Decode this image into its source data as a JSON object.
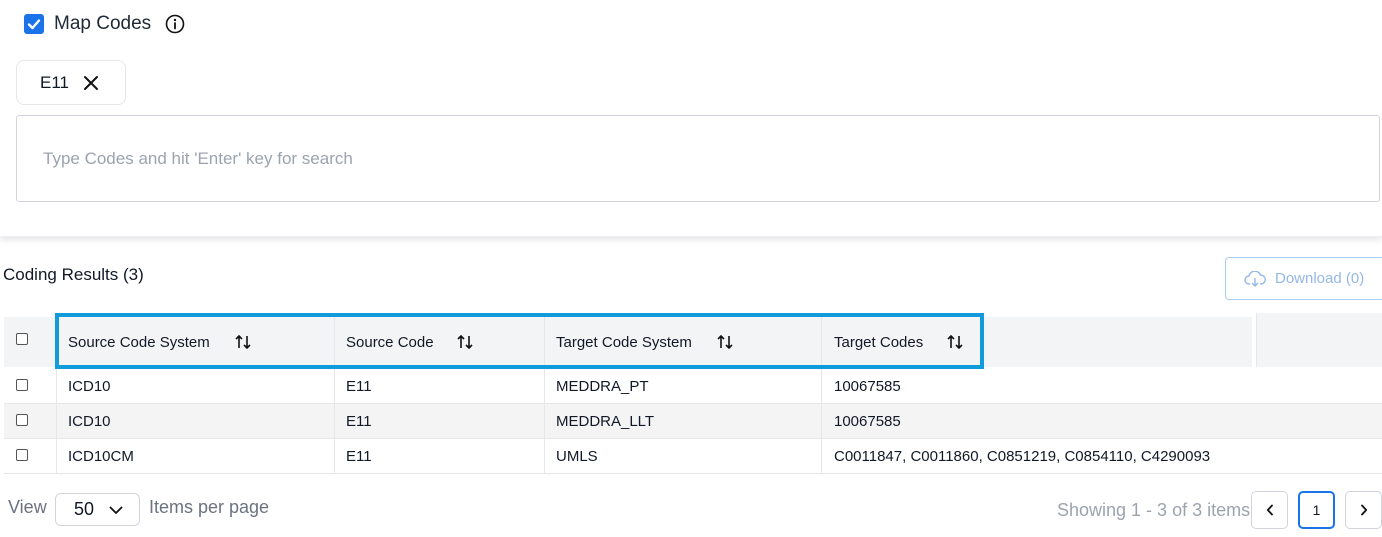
{
  "map_codes": {
    "label": "Map Codes",
    "checked": true,
    "info_icon": "info-icon"
  },
  "chips": [
    {
      "label": "E11"
    }
  ],
  "search": {
    "placeholder": "Type Codes and hit 'Enter' key for search",
    "value": ""
  },
  "results": {
    "title": "Coding Results (3)",
    "download_label": "Download (0)"
  },
  "table": {
    "columns": [
      "Source Code System",
      "Source Code",
      "Target Code System",
      "Target Codes"
    ],
    "rows": [
      [
        "ICD10",
        "E11",
        "MEDDRA_PT",
        "10067585"
      ],
      [
        "ICD10",
        "E11",
        "MEDDRA_LLT",
        "10067585"
      ],
      [
        "ICD10CM",
        "E11",
        "UMLS",
        "C0011847, C0011860, C0851219, C0854110, C4290093"
      ]
    ]
  },
  "pagination": {
    "view_label": "View",
    "per_page": "50",
    "per_page_label": "Items per page",
    "showing": "Showing 1 - 3 of 3 items",
    "current_page": "1"
  },
  "colors": {
    "accent": "#1a73e8",
    "highlight": "#119bdb",
    "download_text": "#94b8e6"
  }
}
